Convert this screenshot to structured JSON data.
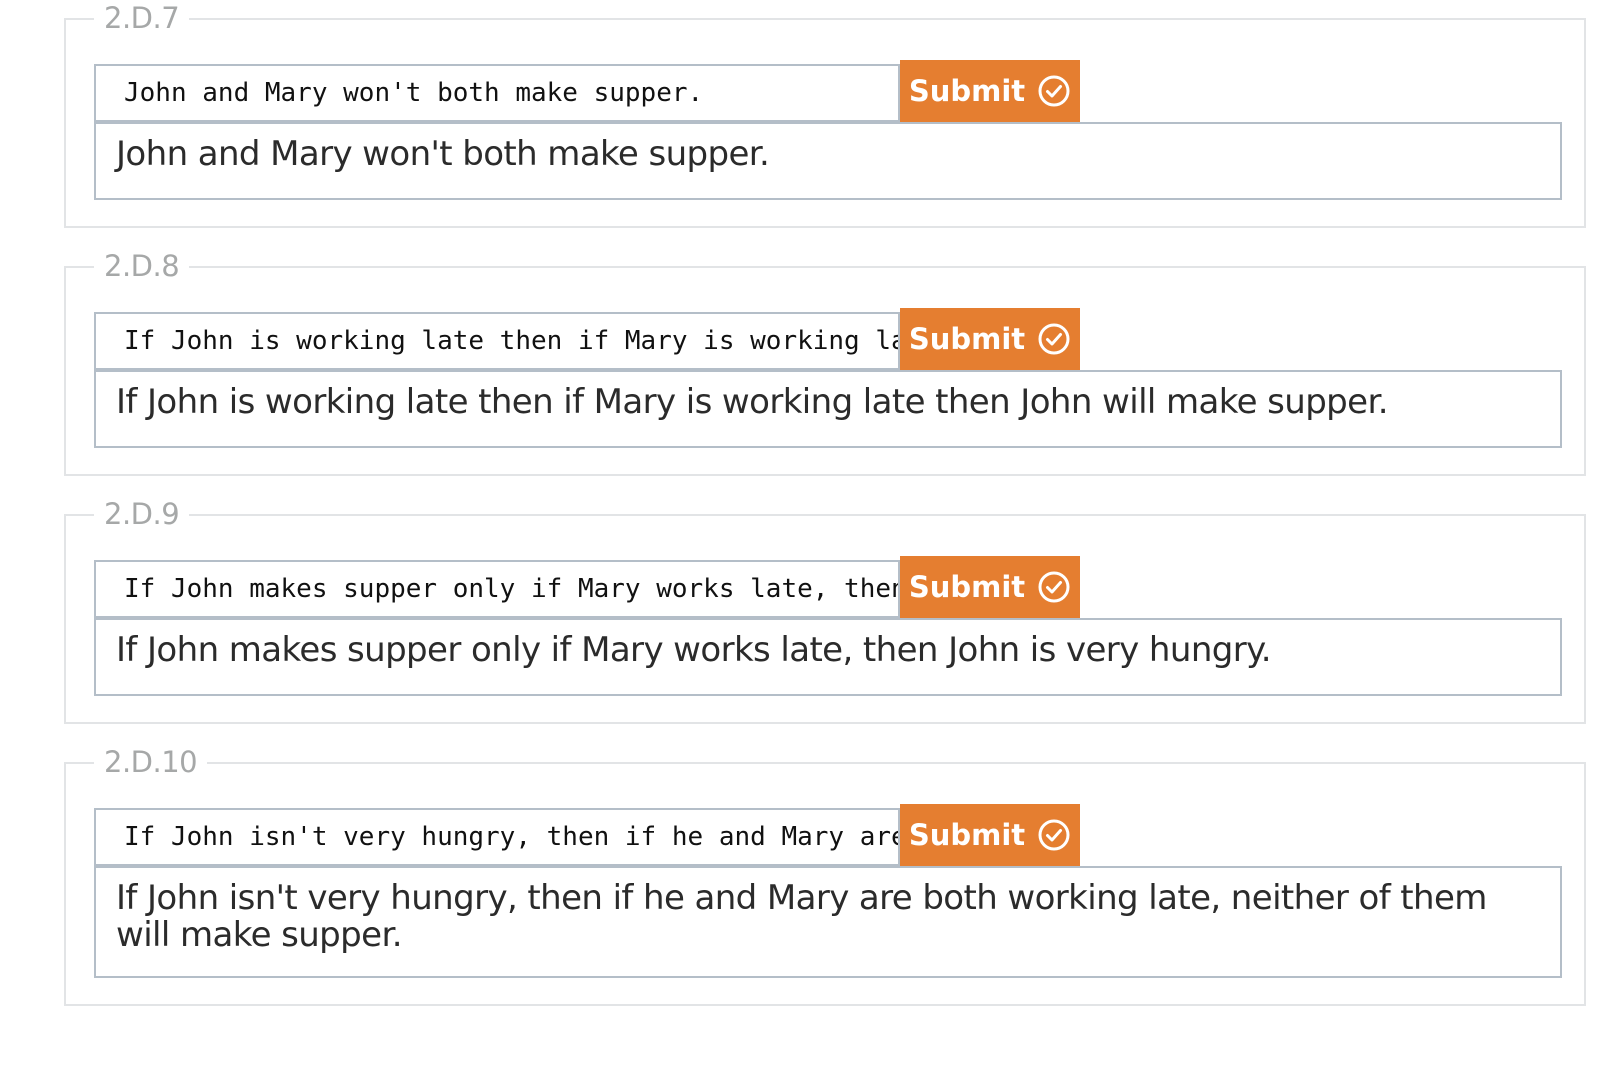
{
  "submit_label": "Submit",
  "exercises": [
    {
      "id": "2.D.7",
      "input_value": "John and Mary won't both make supper.",
      "output": "John and Mary won't both make supper."
    },
    {
      "id": "2.D.8",
      "input_value": "If John is working late then if Mary is working late then John will make supper.",
      "output": "If John is working late then if Mary is working late then John will make supper."
    },
    {
      "id": "2.D.9",
      "input_value": "If John makes supper only if Mary works late, then John is very hungry.",
      "output": "If John makes supper only if Mary works late, then John is very hungry."
    },
    {
      "id": "2.D.10",
      "input_value": "If John isn't very hungry, then if he and Mary are both working late, neither of them will make supper.",
      "output": "If John isn't very hungry, then if he and Mary are both working late, neither of them will make supper."
    }
  ],
  "colors": {
    "accent": "#e57e30",
    "border": "#b4bec8",
    "legend_text": "#a6a8a8"
  },
  "icons": {
    "submit": "check-circle-icon"
  }
}
